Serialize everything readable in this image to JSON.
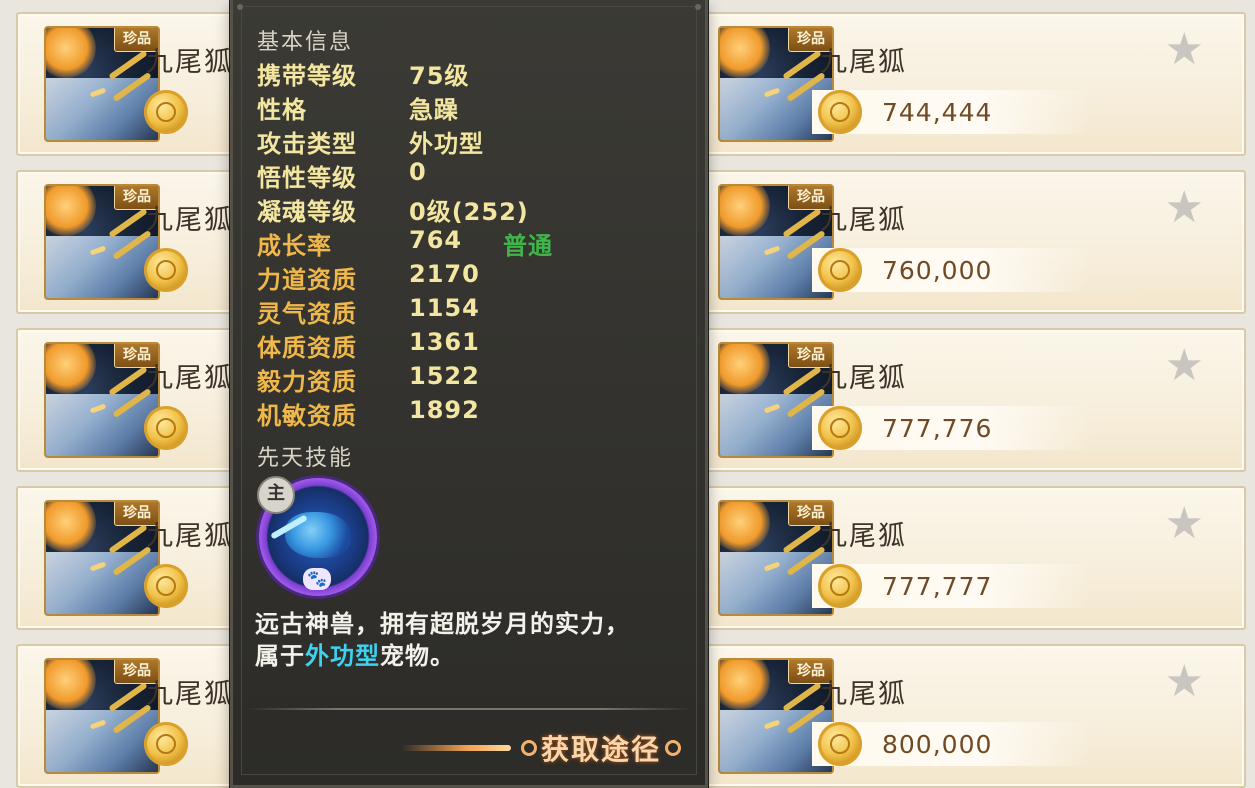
{
  "market": {
    "rows": [
      {
        "left": {
          "badge": "珍品",
          "name": "九尾狐",
          "price": ""
        },
        "right": {
          "badge": "珍品",
          "name": "九尾狐",
          "price": "744,444"
        }
      },
      {
        "left": {
          "badge": "珍品",
          "name": "九尾狐",
          "price": ""
        },
        "right": {
          "badge": "珍品",
          "name": "九尾狐",
          "price": "760,000"
        }
      },
      {
        "left": {
          "badge": "珍品",
          "name": "九尾狐",
          "price": ""
        },
        "right": {
          "badge": "珍品",
          "name": "九尾狐",
          "price": "777,776"
        }
      },
      {
        "left": {
          "badge": "珍品",
          "name": "九尾狐",
          "price": ""
        },
        "right": {
          "badge": "珍品",
          "name": "九尾狐",
          "price": "777,777"
        }
      },
      {
        "left": {
          "badge": "珍品",
          "name": "九尾狐",
          "price": ""
        },
        "right": {
          "badge": "珍品",
          "name": "九尾狐",
          "price": "800,000"
        }
      }
    ],
    "favorite_icon": "star-icon",
    "coin_icon": "coin-icon"
  },
  "tooltip": {
    "basic_title": "基本信息",
    "stats": [
      {
        "label": "携带等级",
        "value": "75级"
      },
      {
        "label": "性格",
        "value": "急躁"
      },
      {
        "label": "攻击类型",
        "value": "外功型"
      },
      {
        "label": "悟性等级",
        "value": "0"
      },
      {
        "label": "凝魂等级",
        "value": "0级(252)"
      },
      {
        "label": "成长率",
        "value": "764",
        "quality": "普通"
      },
      {
        "label": "力道资质",
        "value": "2170"
      },
      {
        "label": "灵气资质",
        "value": "1154"
      },
      {
        "label": "体质资质",
        "value": "1361"
      },
      {
        "label": "毅力资质",
        "value": "1522"
      },
      {
        "label": "机敏资质",
        "value": "1892"
      }
    ],
    "skill_title": "先天技能",
    "skill": {
      "tag": "主",
      "paw": "🐾"
    },
    "desc_part1": "远古神兽，拥有超脱岁月的实力，",
    "desc_part2": "属于",
    "desc_highlight": "外功型",
    "desc_part3": "宠物。",
    "obtain_label": "获取途径"
  },
  "colors": {
    "stat_label": "#f2e6a0",
    "growth_label": "#f0b84a",
    "quality_text": "#3fb54a",
    "highlight": "#3fd2f0"
  }
}
